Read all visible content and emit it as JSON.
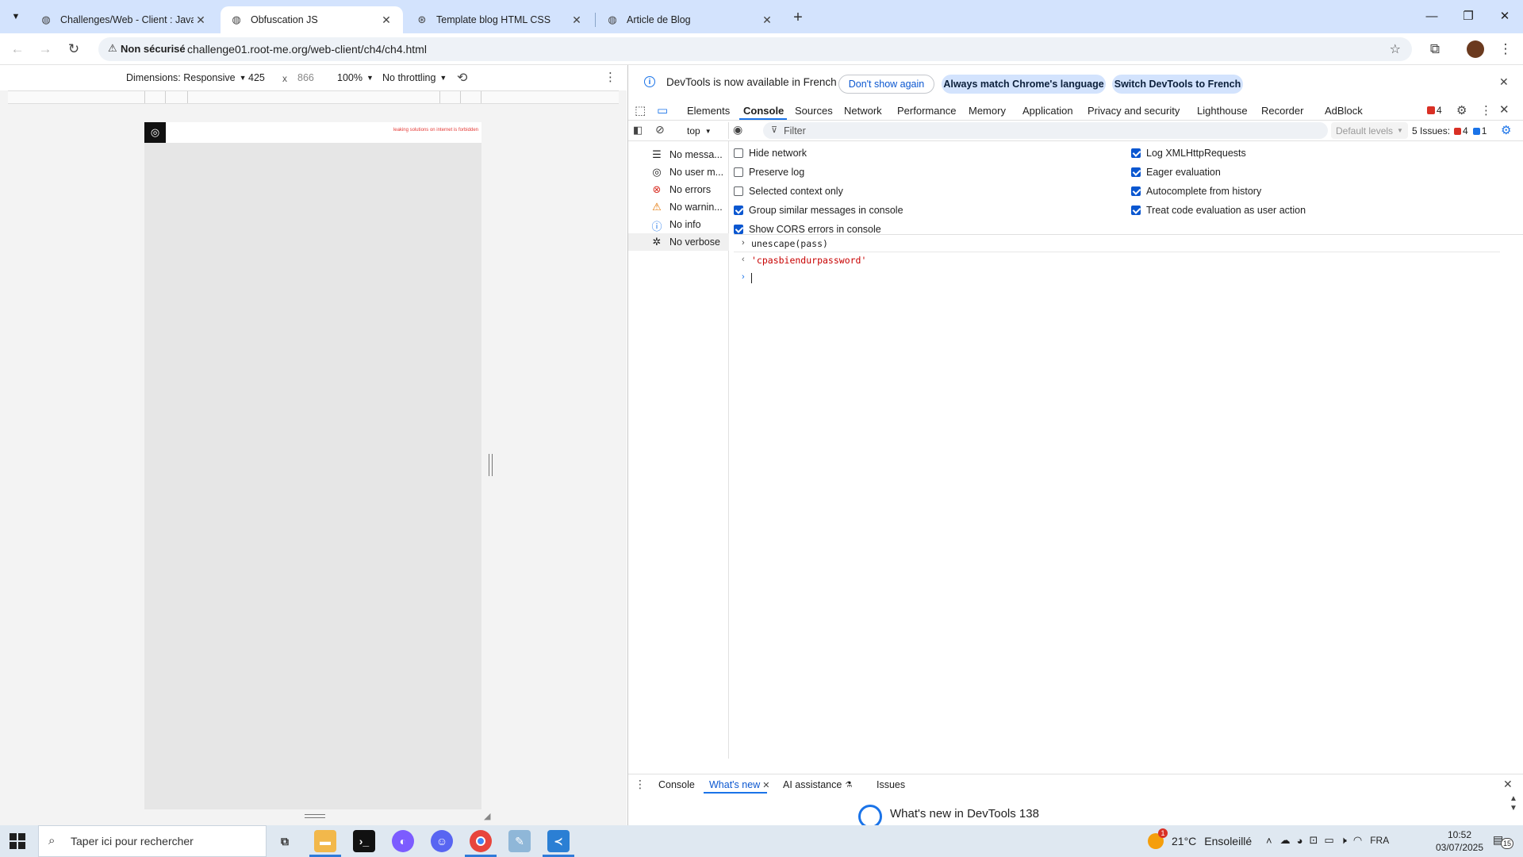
{
  "browser": {
    "tabs": [
      {
        "title": "Challenges/Web - Client : Javas"
      },
      {
        "title": "Obfuscation JS",
        "active": true
      },
      {
        "title": "Template blog HTML CSS"
      },
      {
        "title": "Article de Blog"
      }
    ],
    "new_tab_label": "+",
    "security_label": "Non sécurisé",
    "url": "challenge01.root-me.org/web-client/ch4/ch4.html"
  },
  "device_toolbar": {
    "dimensions_label": "Dimensions: Responsive",
    "width": "425",
    "times": "x",
    "height": "866",
    "zoom": "100%",
    "throttling": "No throttling"
  },
  "page": {
    "warning_text": "leaking solutions on internet is forbidden"
  },
  "devtools": {
    "info_message": "DevTools is now available in French",
    "dont_show_again": "Don't show again",
    "always_match": "Always match Chrome's language",
    "switch_french": "Switch DevTools to French",
    "tabs": [
      "Elements",
      "Console",
      "Sources",
      "Network",
      "Performance",
      "Memory",
      "Application",
      "Privacy and security",
      "Lighthouse",
      "Recorder",
      "AdBlock"
    ],
    "error_count": "4",
    "context": "top",
    "filter_placeholder": "Filter",
    "default_levels": "Default levels",
    "issues_label": "5 Issues:",
    "issues_errors": "4",
    "issues_info": "1",
    "sidebar": [
      {
        "label": "No messa...",
        "icon": "list-icon"
      },
      {
        "label": "No user m...",
        "icon": "user-icon"
      },
      {
        "label": "No errors",
        "icon": "error-icon"
      },
      {
        "label": "No warnin...",
        "icon": "warning-icon"
      },
      {
        "label": "No info",
        "icon": "info-icon"
      },
      {
        "label": "No verbose",
        "icon": "bug-icon"
      }
    ],
    "settings_left": [
      {
        "label": "Hide network",
        "checked": false
      },
      {
        "label": "Preserve log",
        "checked": false
      },
      {
        "label": "Selected context only",
        "checked": false
      },
      {
        "label": "Group similar messages in console",
        "checked": true
      },
      {
        "label": "Show CORS errors in console",
        "checked": true
      }
    ],
    "settings_right": [
      {
        "label": "Log XMLHttpRequests",
        "checked": true
      },
      {
        "label": "Eager evaluation",
        "checked": true
      },
      {
        "label": "Autocomplete from history",
        "checked": true
      },
      {
        "label": "Treat code evaluation as user action",
        "checked": true
      }
    ],
    "console_input": "unescape(pass)",
    "console_output": "'cpasbiendurpassword'",
    "drawer_tabs": [
      "Console",
      "What's new",
      "AI assistance",
      "Issues"
    ],
    "drawer_title": "What's new in DevTools 138"
  },
  "taskbar": {
    "search_placeholder": "Taper ici pour rechercher",
    "weather_temp": "21°C",
    "weather_desc": "Ensoleillé",
    "weather_badge": "1",
    "language": "FRA",
    "time": "10:52",
    "date": "03/07/2025",
    "notifications": "15"
  },
  "colors": {
    "accent": "#1a73e8",
    "error": "#d93025",
    "string": "#c80000"
  }
}
